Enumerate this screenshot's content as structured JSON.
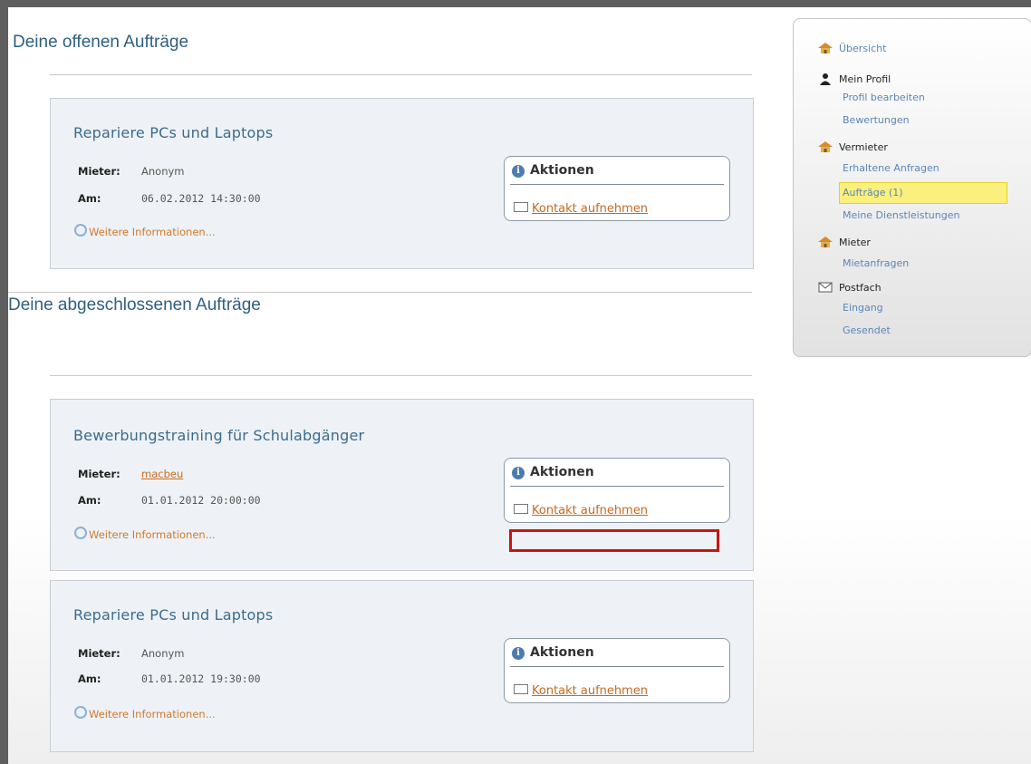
{
  "page": {
    "open_title": "Deine offenen Aufträge",
    "closed_title": "Deine abgeschlossenen Aufträge"
  },
  "open_orders": [
    {
      "title": "Repariere PCs und Laptops",
      "mieter_label": "Mieter:",
      "mieter": "Anonym",
      "am_label": "Am:",
      "date": "06.02.2012 14:30:00",
      "more": "Weitere Informationen...",
      "aktionen": "Aktionen",
      "contact": "Kontakt aufnehmen"
    }
  ],
  "closed_orders": [
    {
      "title": "Bewerbungstraining für Schulabgänger",
      "mieter_label": "Mieter:",
      "mieter": "macbeu",
      "am_label": "Am:",
      "date": "01.01.2012 20:00:00",
      "more": "Weitere Informationen...",
      "aktionen": "Aktionen",
      "contact": "Kontakt aufnehmen"
    },
    {
      "title": "Repariere PCs und Laptops",
      "mieter_label": "Mieter:",
      "mieter": "Anonym",
      "am_label": "Am:",
      "date": "01.01.2012 19:30:00",
      "more": "Weitere Informationen...",
      "aktionen": "Aktionen",
      "contact": "Kontakt aufnehmen"
    }
  ],
  "sidebar": {
    "overview": "Übersicht",
    "profile": "Mein Profil",
    "profile_items": [
      "Profil bearbeiten",
      "Bewertungen"
    ],
    "vermieter": "Vermieter",
    "vermieter_items": [
      "Erhaltene Anfragen",
      "Aufträge (1)",
      "Meine Dienstleistungen"
    ],
    "mieter": "Mieter",
    "mieter_items": [
      "Mietanfragen"
    ],
    "postfach": "Postfach",
    "postfach_items": [
      "Eingang",
      "Gesendet"
    ]
  },
  "icons": {
    "overview": "house-icon",
    "profile": "person-icon",
    "vermieter": "house-icon",
    "mieter": "house-icon",
    "postfach": "envelope-icon",
    "info": "info-icon",
    "contact": "envelope-icon",
    "more": "magnifier-icon"
  },
  "colors": {
    "title": "#2f5f7f",
    "link": "#c66a1e",
    "sidebar_link": "#5b86b5",
    "active_highlight": "#fbf07c",
    "annotation": "#cc1111"
  }
}
